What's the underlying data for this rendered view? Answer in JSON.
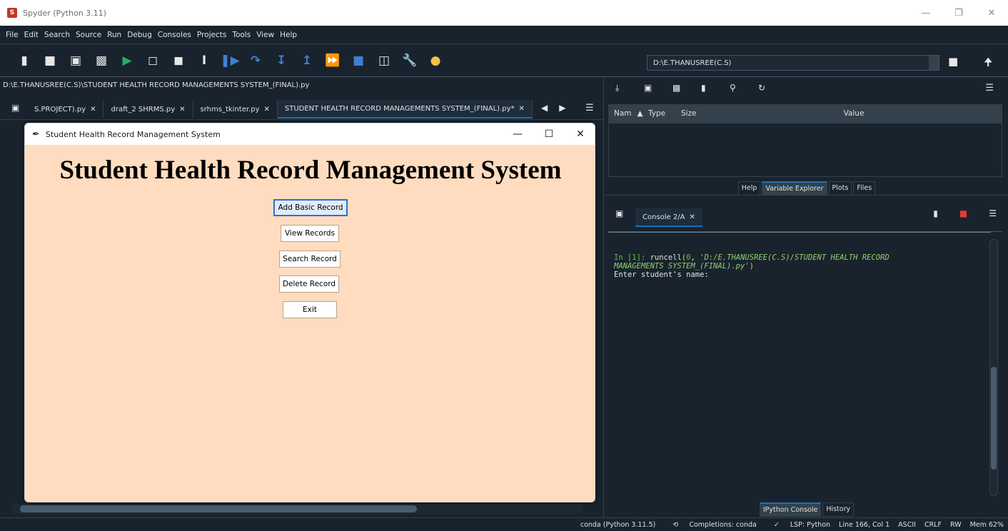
{
  "window": {
    "title": "Spyder (Python 3.11)",
    "icon": "spyder-app-icon"
  },
  "menubar": [
    "File",
    "Edit",
    "Search",
    "Source",
    "Run",
    "Debug",
    "Consoles",
    "Projects",
    "Tools",
    "View",
    "Help"
  ],
  "toolbar": {
    "icons": [
      "new-file",
      "open-file",
      "save-file",
      "save-all",
      "run",
      "run-cell",
      "run-cell-advance",
      "run-selection",
      "debug",
      "step-over",
      "step-into",
      "step-return",
      "continue",
      "stop",
      "maximize-pane",
      "preferences",
      "python-path"
    ],
    "working_directory": "D:\\E.THANUSREE(C.S)"
  },
  "editor": {
    "file_path": "D:\\E.THANUSREE(C.S)\\STUDENT HEALTH RECORD MANAGEMENTS SYSTEM_(FINAL).py",
    "tabs": [
      {
        "label": "S.PROJECT).py",
        "active": false
      },
      {
        "label": "draft_2 SHRMS.py",
        "active": false
      },
      {
        "label": "srhms_tkinter.py",
        "active": false
      },
      {
        "label": "STUDENT HEALTH RECORD MANAGEMENTS SYSTEM_(FINAL).py*",
        "active": true
      }
    ]
  },
  "tk_window": {
    "title": "Student Health Record Management System",
    "heading": "Student Health Record Management System",
    "bg_color": "#ffdcbf",
    "buttons": [
      "Add Basic Record",
      "View Records",
      "Search Record",
      "Delete Record",
      "Exit"
    ]
  },
  "variable_explorer": {
    "columns": [
      "Nam",
      "Type",
      "Size",
      "Value"
    ],
    "pane_tabs": [
      "Help",
      "Variable Explorer",
      "Plots",
      "Files"
    ],
    "active_tab": "Variable Explorer"
  },
  "console": {
    "tab_label": "Console 2/A",
    "prompt": "In [1]:",
    "command": "runcell",
    "args_open": "(",
    "arg_num": "0",
    "arg_sep": ", ",
    "arg_path_1": "'D:/E.THANUSREE(C.S)/STUDENT HEALTH RECORD",
    "arg_path_2": "MANAGEMENTS SYSTEM_(FINAL).py'",
    "args_close": ")",
    "output": "Enter student's name:",
    "pane_tabs": [
      "IPython Console",
      "History"
    ],
    "active_tab": "IPython Console"
  },
  "statusbar": [
    "conda (Python 3.11.5)",
    "Completions: conda",
    "LSP: Python",
    "Line 166, Col 1",
    "ASCII",
    "CRLF",
    "RW",
    "Mem 62%"
  ]
}
